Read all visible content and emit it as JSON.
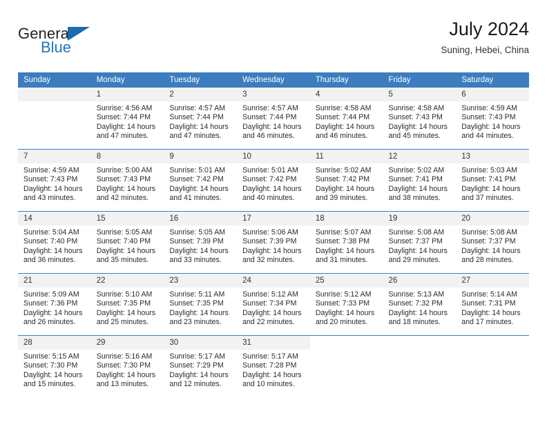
{
  "brand": {
    "name_top": "General",
    "name_bottom": "Blue",
    "triangle_color": "#1d6cb0",
    "blue_color": "#1d76bc"
  },
  "header": {
    "title": "July 2024",
    "subtitle": "Suning, Hebei, China",
    "header_bg": "#3b7dbf",
    "daynum_bg": "#f2f2f2"
  },
  "weekdays": [
    "Sunday",
    "Monday",
    "Tuesday",
    "Wednesday",
    "Thursday",
    "Friday",
    "Saturday"
  ],
  "weeks": [
    [
      {
        "day": "",
        "sunrise": "",
        "sunset": "",
        "daylight1": "",
        "daylight2": ""
      },
      {
        "day": "1",
        "sunrise": "Sunrise: 4:56 AM",
        "sunset": "Sunset: 7:44 PM",
        "daylight1": "Daylight: 14 hours",
        "daylight2": "and 47 minutes."
      },
      {
        "day": "2",
        "sunrise": "Sunrise: 4:57 AM",
        "sunset": "Sunset: 7:44 PM",
        "daylight1": "Daylight: 14 hours",
        "daylight2": "and 47 minutes."
      },
      {
        "day": "3",
        "sunrise": "Sunrise: 4:57 AM",
        "sunset": "Sunset: 7:44 PM",
        "daylight1": "Daylight: 14 hours",
        "daylight2": "and 46 minutes."
      },
      {
        "day": "4",
        "sunrise": "Sunrise: 4:58 AM",
        "sunset": "Sunset: 7:44 PM",
        "daylight1": "Daylight: 14 hours",
        "daylight2": "and 46 minutes."
      },
      {
        "day": "5",
        "sunrise": "Sunrise: 4:58 AM",
        "sunset": "Sunset: 7:43 PM",
        "daylight1": "Daylight: 14 hours",
        "daylight2": "and 45 minutes."
      },
      {
        "day": "6",
        "sunrise": "Sunrise: 4:59 AM",
        "sunset": "Sunset: 7:43 PM",
        "daylight1": "Daylight: 14 hours",
        "daylight2": "and 44 minutes."
      }
    ],
    [
      {
        "day": "7",
        "sunrise": "Sunrise: 4:59 AM",
        "sunset": "Sunset: 7:43 PM",
        "daylight1": "Daylight: 14 hours",
        "daylight2": "and 43 minutes."
      },
      {
        "day": "8",
        "sunrise": "Sunrise: 5:00 AM",
        "sunset": "Sunset: 7:43 PM",
        "daylight1": "Daylight: 14 hours",
        "daylight2": "and 42 minutes."
      },
      {
        "day": "9",
        "sunrise": "Sunrise: 5:01 AM",
        "sunset": "Sunset: 7:42 PM",
        "daylight1": "Daylight: 14 hours",
        "daylight2": "and 41 minutes."
      },
      {
        "day": "10",
        "sunrise": "Sunrise: 5:01 AM",
        "sunset": "Sunset: 7:42 PM",
        "daylight1": "Daylight: 14 hours",
        "daylight2": "and 40 minutes."
      },
      {
        "day": "11",
        "sunrise": "Sunrise: 5:02 AM",
        "sunset": "Sunset: 7:42 PM",
        "daylight1": "Daylight: 14 hours",
        "daylight2": "and 39 minutes."
      },
      {
        "day": "12",
        "sunrise": "Sunrise: 5:02 AM",
        "sunset": "Sunset: 7:41 PM",
        "daylight1": "Daylight: 14 hours",
        "daylight2": "and 38 minutes."
      },
      {
        "day": "13",
        "sunrise": "Sunrise: 5:03 AM",
        "sunset": "Sunset: 7:41 PM",
        "daylight1": "Daylight: 14 hours",
        "daylight2": "and 37 minutes."
      }
    ],
    [
      {
        "day": "14",
        "sunrise": "Sunrise: 5:04 AM",
        "sunset": "Sunset: 7:40 PM",
        "daylight1": "Daylight: 14 hours",
        "daylight2": "and 36 minutes."
      },
      {
        "day": "15",
        "sunrise": "Sunrise: 5:05 AM",
        "sunset": "Sunset: 7:40 PM",
        "daylight1": "Daylight: 14 hours",
        "daylight2": "and 35 minutes."
      },
      {
        "day": "16",
        "sunrise": "Sunrise: 5:05 AM",
        "sunset": "Sunset: 7:39 PM",
        "daylight1": "Daylight: 14 hours",
        "daylight2": "and 33 minutes."
      },
      {
        "day": "17",
        "sunrise": "Sunrise: 5:06 AM",
        "sunset": "Sunset: 7:39 PM",
        "daylight1": "Daylight: 14 hours",
        "daylight2": "and 32 minutes."
      },
      {
        "day": "18",
        "sunrise": "Sunrise: 5:07 AM",
        "sunset": "Sunset: 7:38 PM",
        "daylight1": "Daylight: 14 hours",
        "daylight2": "and 31 minutes."
      },
      {
        "day": "19",
        "sunrise": "Sunrise: 5:08 AM",
        "sunset": "Sunset: 7:37 PM",
        "daylight1": "Daylight: 14 hours",
        "daylight2": "and 29 minutes."
      },
      {
        "day": "20",
        "sunrise": "Sunrise: 5:08 AM",
        "sunset": "Sunset: 7:37 PM",
        "daylight1": "Daylight: 14 hours",
        "daylight2": "and 28 minutes."
      }
    ],
    [
      {
        "day": "21",
        "sunrise": "Sunrise: 5:09 AM",
        "sunset": "Sunset: 7:36 PM",
        "daylight1": "Daylight: 14 hours",
        "daylight2": "and 26 minutes."
      },
      {
        "day": "22",
        "sunrise": "Sunrise: 5:10 AM",
        "sunset": "Sunset: 7:35 PM",
        "daylight1": "Daylight: 14 hours",
        "daylight2": "and 25 minutes."
      },
      {
        "day": "23",
        "sunrise": "Sunrise: 5:11 AM",
        "sunset": "Sunset: 7:35 PM",
        "daylight1": "Daylight: 14 hours",
        "daylight2": "and 23 minutes."
      },
      {
        "day": "24",
        "sunrise": "Sunrise: 5:12 AM",
        "sunset": "Sunset: 7:34 PM",
        "daylight1": "Daylight: 14 hours",
        "daylight2": "and 22 minutes."
      },
      {
        "day": "25",
        "sunrise": "Sunrise: 5:12 AM",
        "sunset": "Sunset: 7:33 PM",
        "daylight1": "Daylight: 14 hours",
        "daylight2": "and 20 minutes."
      },
      {
        "day": "26",
        "sunrise": "Sunrise: 5:13 AM",
        "sunset": "Sunset: 7:32 PM",
        "daylight1": "Daylight: 14 hours",
        "daylight2": "and 18 minutes."
      },
      {
        "day": "27",
        "sunrise": "Sunrise: 5:14 AM",
        "sunset": "Sunset: 7:31 PM",
        "daylight1": "Daylight: 14 hours",
        "daylight2": "and 17 minutes."
      }
    ],
    [
      {
        "day": "28",
        "sunrise": "Sunrise: 5:15 AM",
        "sunset": "Sunset: 7:30 PM",
        "daylight1": "Daylight: 14 hours",
        "daylight2": "and 15 minutes."
      },
      {
        "day": "29",
        "sunrise": "Sunrise: 5:16 AM",
        "sunset": "Sunset: 7:30 PM",
        "daylight1": "Daylight: 14 hours",
        "daylight2": "and 13 minutes."
      },
      {
        "day": "30",
        "sunrise": "Sunrise: 5:17 AM",
        "sunset": "Sunset: 7:29 PM",
        "daylight1": "Daylight: 14 hours",
        "daylight2": "and 12 minutes."
      },
      {
        "day": "31",
        "sunrise": "Sunrise: 5:17 AM",
        "sunset": "Sunset: 7:28 PM",
        "daylight1": "Daylight: 14 hours",
        "daylight2": "and 10 minutes."
      },
      {
        "day": "",
        "sunrise": "",
        "sunset": "",
        "daylight1": "",
        "daylight2": ""
      },
      {
        "day": "",
        "sunrise": "",
        "sunset": "",
        "daylight1": "",
        "daylight2": ""
      },
      {
        "day": "",
        "sunrise": "",
        "sunset": "",
        "daylight1": "",
        "daylight2": ""
      }
    ]
  ]
}
